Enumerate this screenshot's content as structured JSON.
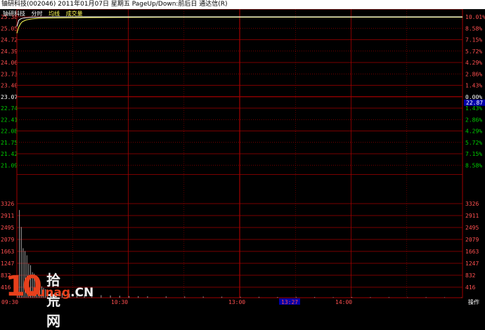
{
  "window": {
    "title": "铀研科技(002046) 2011年01月07日 星期五 PageUp/Down:前后日 通达信(R)"
  },
  "legend": {
    "name": "铀研科技",
    "price_label": "分时",
    "avg_label": "均线",
    "volume_label": "成交量"
  },
  "colors": {
    "grid": "#a00000",
    "price_line": "#ffffff",
    "avg_line": "#ffff55",
    "volume": "#a0a0a0",
    "up_text": "#ff5050",
    "down_text": "#00cc00",
    "neutral_text": "#ffffff",
    "highlight_bg": "#0000aa"
  },
  "watermark": {
    "number": "10",
    "chinese": "拾荒网",
    "domain_a": "Hunag",
    "domain_b": ".CN"
  },
  "bottom_bar": {
    "action_label": "操作"
  },
  "chart_data": {
    "type": "line",
    "title": "",
    "price_axis": {
      "labels": [
        "25.38",
        "25.05",
        "24.72",
        "24.39",
        "24.06",
        "23.73",
        "23.40",
        "23.07",
        "22.74",
        "22.41",
        "22.08",
        "21.75",
        "21.42",
        "21.09"
      ],
      "reference_price": "23.07",
      "min": 20.76,
      "max": 25.38
    },
    "percent_axis": {
      "labels": [
        "10.01%",
        "8.58%",
        "7.15%",
        "5.72%",
        "4.29%",
        "2.86%",
        "1.43%",
        "0.00%",
        "1.43%",
        "2.86%",
        "4.29%",
        "5.72%",
        "7.15%",
        "8.58%"
      ],
      "cursor_price": "22.87"
    },
    "volume_axis": {
      "labels_left": [
        "3326",
        "2911",
        "2495",
        "2079",
        "1663",
        "1247",
        "832",
        "416"
      ],
      "labels_right": [
        "3326",
        "2911",
        "2495",
        "2079",
        "1663",
        "1247",
        "832",
        "416"
      ],
      "max": 3326
    },
    "time_axis": {
      "labels": [
        "09:30",
        "10:30",
        "13:00",
        "13:27",
        "14:00"
      ],
      "highlight": "13:27"
    },
    "price_series": {
      "name": "分时",
      "minutes": [
        0,
        1,
        2,
        3,
        4,
        6,
        8,
        12,
        20,
        40,
        80,
        120,
        160,
        200,
        240
      ],
      "values": [
        25.1,
        25.28,
        25.32,
        25.34,
        25.35,
        25.36,
        25.37,
        25.37,
        25.38,
        25.38,
        25.38,
        25.38,
        25.38,
        25.38,
        25.38
      ]
    },
    "avg_series": {
      "name": "均线",
      "minutes": [
        0,
        1,
        2,
        3,
        5,
        8,
        12,
        20,
        40,
        80,
        120,
        160,
        200,
        240
      ],
      "values": [
        24.9,
        25.08,
        25.18,
        25.24,
        25.29,
        25.32,
        25.34,
        25.35,
        25.36,
        25.37,
        25.37,
        25.37,
        25.37,
        25.37
      ]
    },
    "volume_series": {
      "name": "成交量",
      "minutes": [
        0,
        1,
        2,
        3,
        4,
        5,
        6,
        7,
        8,
        9,
        10,
        11,
        12,
        13,
        14,
        15,
        16,
        18,
        20,
        24,
        28,
        32,
        36,
        40,
        45,
        50,
        55,
        60,
        65,
        70,
        80,
        90,
        100,
        110,
        120,
        130,
        140,
        150,
        160,
        170,
        180,
        190,
        200,
        210,
        220,
        230,
        239
      ],
      "values": [
        700,
        3100,
        2500,
        1750,
        1650,
        1500,
        1200,
        1150,
        900,
        850,
        700,
        600,
        500,
        400,
        350,
        300,
        260,
        220,
        180,
        160,
        140,
        120,
        110,
        100,
        90,
        80,
        70,
        60,
        55,
        50,
        45,
        40,
        40,
        35,
        30,
        30,
        25,
        30,
        25,
        20,
        25,
        20,
        20,
        15,
        20,
        15,
        10
      ]
    }
  }
}
